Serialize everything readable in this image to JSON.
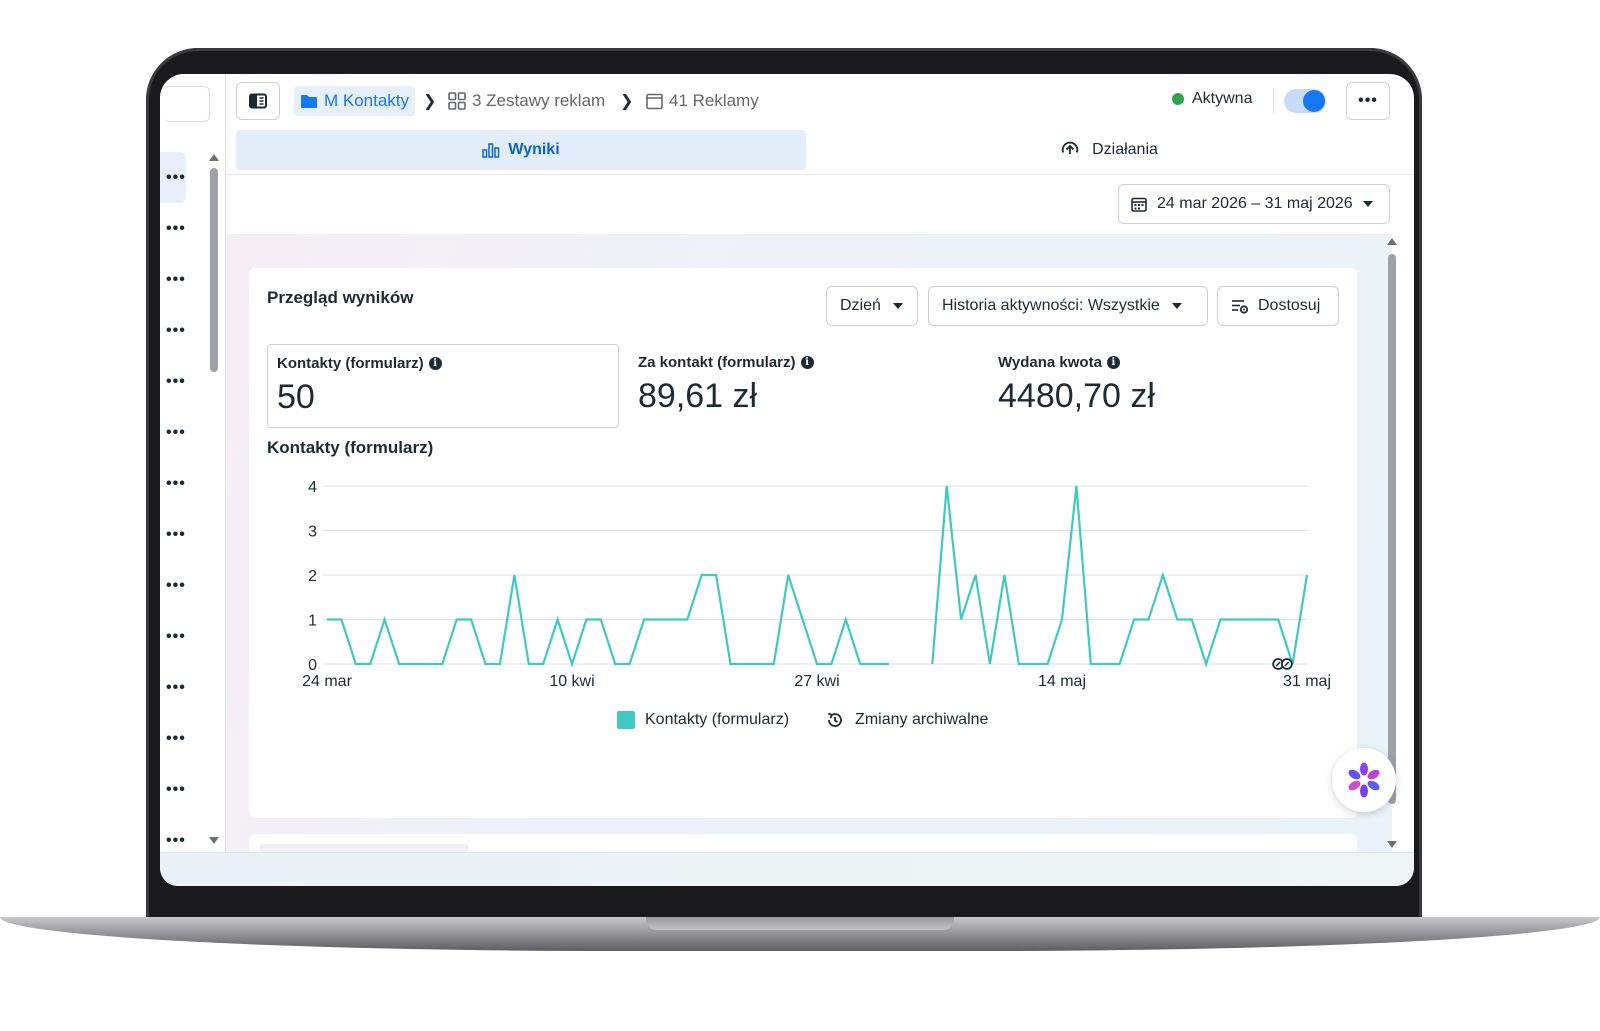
{
  "breadcrumb": {
    "campaign": "M Kontakty",
    "adsets": "3 Zestawy reklam",
    "ads": "41 Reklamy"
  },
  "status": {
    "label": "Aktywna",
    "toggle_on": true,
    "color": "#31a24c"
  },
  "tabs": {
    "results": "Wyniki",
    "actions": "Działania"
  },
  "date_range": "24 mar 2026 – 31 maj 2026",
  "overview": {
    "title": "Przegląd wyników",
    "granularity": "Dzień",
    "history_filter": "Historia aktywności: Wszystkie",
    "customize": "Dostosuj"
  },
  "metrics": [
    {
      "label": "Kontakty (formularz)",
      "value": "50"
    },
    {
      "label": "Za kontakt (formularz)",
      "value": "89,61 zł"
    },
    {
      "label": "Wydana kwota",
      "value": "4480,70 zł"
    }
  ],
  "chart_data": {
    "type": "line",
    "title": "Kontakty (formularz)",
    "xlabel": "",
    "ylabel": "",
    "ylim": [
      0,
      4
    ],
    "yticks": [
      "0",
      "1",
      "2",
      "3",
      "4"
    ],
    "xtick_labels": [
      "24 mar",
      "10 kwi",
      "27 kwi",
      "14 maj",
      "31 maj"
    ],
    "xtick_days": [
      0,
      17,
      34,
      51,
      68
    ],
    "grid": true,
    "color": "#3ec9c1",
    "series": [
      {
        "name": "Kontakty (formularz)",
        "values": [
          1,
          1,
          0,
          0,
          1,
          0,
          0,
          0,
          0,
          1,
          1,
          0,
          0,
          2,
          0,
          0,
          1,
          0,
          1,
          1,
          0,
          0,
          1,
          1,
          1,
          1,
          2,
          2,
          0,
          0,
          0,
          0,
          2,
          1,
          0,
          0,
          1,
          0,
          0,
          0,
          null,
          null,
          0,
          4,
          1,
          2,
          0,
          2,
          0,
          0,
          0,
          1,
          4,
          0,
          0,
          0,
          1,
          1,
          2,
          1,
          1,
          0,
          1,
          1,
          1,
          1,
          1,
          0,
          2
        ]
      }
    ],
    "legend": [
      "Kontakty (formularz)",
      "Zmiany archiwalne"
    ],
    "legend_position": "bottom"
  }
}
